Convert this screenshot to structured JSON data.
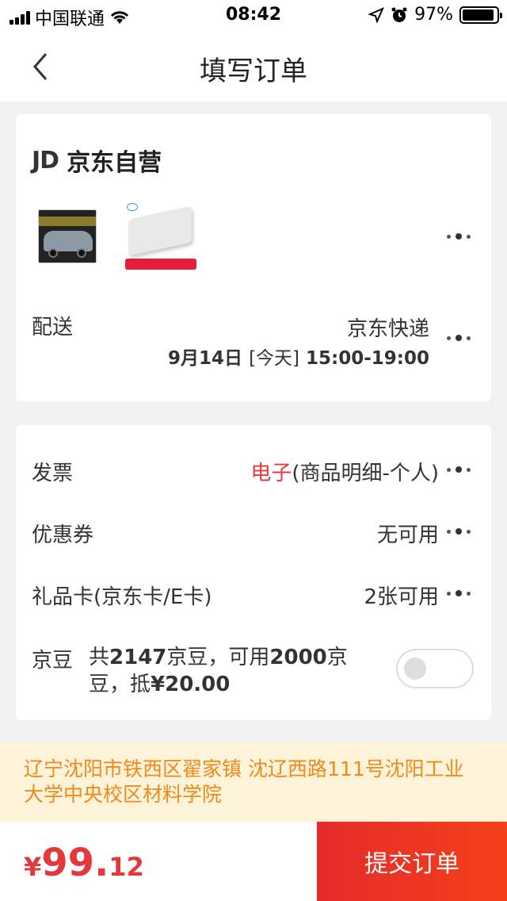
{
  "status_bar": {
    "carrier": "中国联通",
    "time": "08:42",
    "battery": "97%"
  },
  "nav": {
    "title": "填写订单"
  },
  "shop": {
    "logo": "JD",
    "name": "京东自营"
  },
  "delivery": {
    "label": "配送",
    "carrier": "京东快递",
    "date": "9月14日",
    "day": "[今天]",
    "time_range": "15:00-19:00"
  },
  "invoice": {
    "label": "发票",
    "type": "电子",
    "detail": "(商品明细-个人)"
  },
  "coupon": {
    "label": "优惠券",
    "value": "无可用"
  },
  "gift_card": {
    "label": "礼品卡(京东卡/E卡)",
    "value": "2张可用"
  },
  "beans": {
    "label": "京豆",
    "line1_prefix": "共",
    "total": "2147",
    "line1_mid": "京豆，可用",
    "usable": "2000",
    "line1_suffix": "京",
    "line2_prefix": "豆，抵",
    "deduct": "¥20.00",
    "enabled": false
  },
  "address": {
    "text": "辽宁沈阳市铁西区翟家镇 沈辽西路111号沈阳工业大学中央校区材料学院"
  },
  "footer": {
    "currency": "¥",
    "price_int": "99.",
    "price_dec": "12",
    "submit_label": "提交订单"
  },
  "colors": {
    "accent": "#e4393c",
    "address_text": "#f08a1a",
    "address_bg": "#fdf3d9"
  }
}
